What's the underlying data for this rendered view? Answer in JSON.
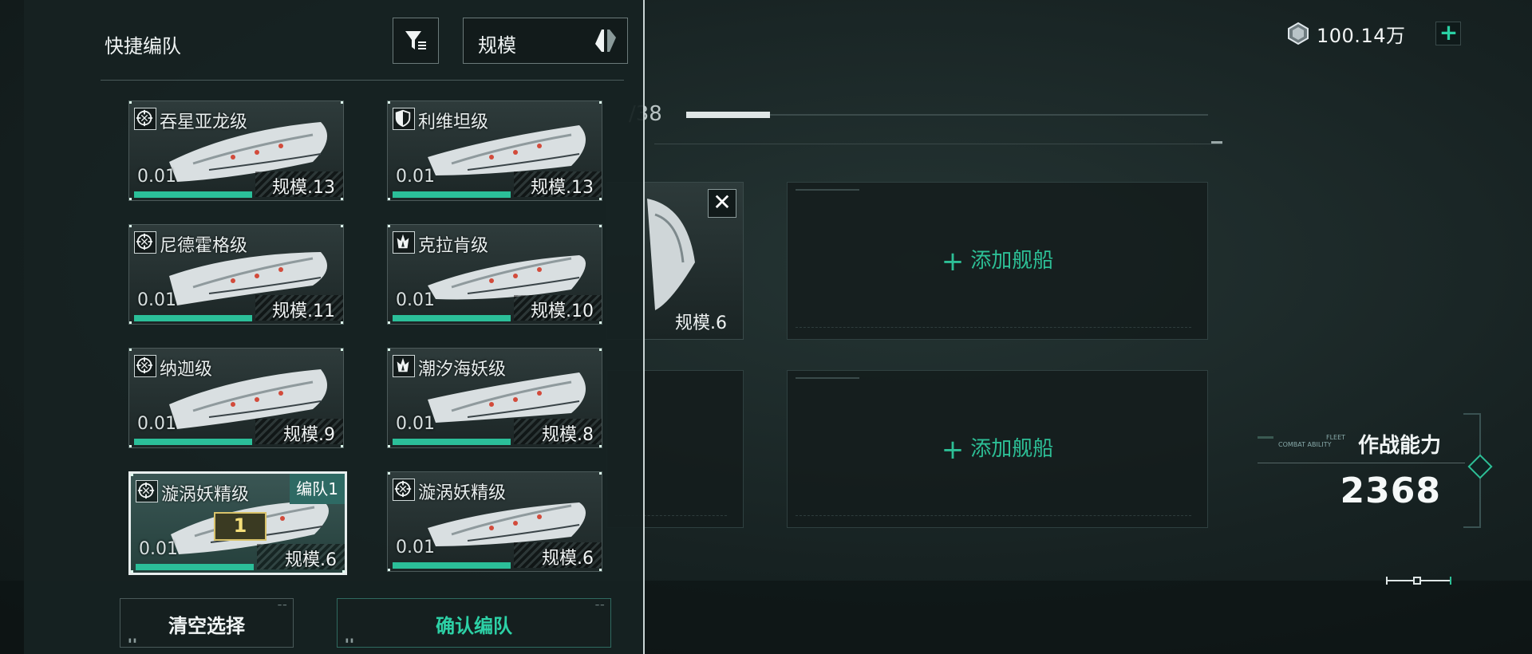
{
  "currency": {
    "amount": "100.14万",
    "icon": "crystal-icon",
    "add_icon": "plus-icon"
  },
  "fleet": {
    "count_suffix": "/38",
    "progress": 0.16
  },
  "slots": {
    "add_ship_label": "添加舰船",
    "partial_ship_scale": "规模.6"
  },
  "combat": {
    "title": "作战能力",
    "sub_en_1": "FLEET",
    "sub_en_2": "COMBAT ABILITY",
    "value": "2368"
  },
  "panel": {
    "title": "快捷编队",
    "sort_label": "规模",
    "clear_label": "清空选择",
    "confirm_label": "确认编队",
    "cards": [
      {
        "name": "吞星亚龙级",
        "value": "0.01",
        "scale": "规模.13",
        "type_icon": "crosshair-icon"
      },
      {
        "name": "利维坦级",
        "value": "0.01",
        "scale": "规模.13",
        "type_icon": "shield-icon"
      },
      {
        "name": "尼德霍格级",
        "value": "0.01",
        "scale": "规模.11",
        "type_icon": "crosshair-icon"
      },
      {
        "name": "克拉肯级",
        "value": "0.01",
        "scale": "规模.10",
        "type_icon": "flame-icon"
      },
      {
        "name": "纳迦级",
        "value": "0.01",
        "scale": "规模.9",
        "type_icon": "crosshair-icon"
      },
      {
        "name": "潮汐海妖级",
        "value": "0.01",
        "scale": "规模.8",
        "type_icon": "flame-icon"
      },
      {
        "name": "漩涡妖精级",
        "value": "0.01",
        "scale": "规模.6",
        "type_icon": "crosshair-icon",
        "badge": "编队1",
        "order": "1"
      },
      {
        "name": "漩涡妖精级",
        "value": "0.01",
        "scale": "规模.6",
        "type_icon": "crosshair-icon"
      }
    ]
  }
}
